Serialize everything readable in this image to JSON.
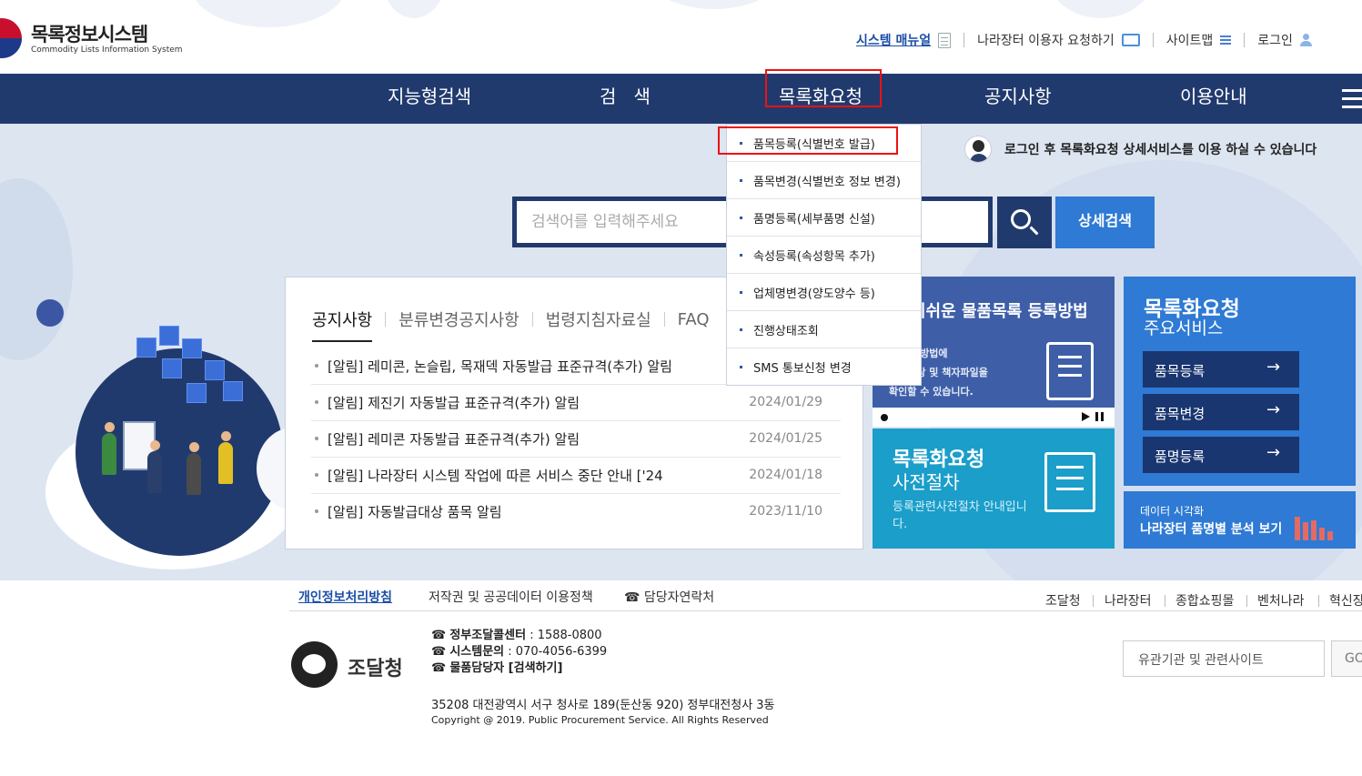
{
  "header": {
    "logo_title": "목록정보시스템",
    "logo_subtitle": "Commodity Lists Information System",
    "util": {
      "manual": "시스템 매뉴얼",
      "user_request": "나라장터 이용자 요청하기",
      "sitemap": "사이트맵",
      "login": "로그인"
    }
  },
  "nav": {
    "items": [
      "지능형검색",
      "검   색",
      "목록화요청",
      "공지사항",
      "이용안내"
    ]
  },
  "dropdown": {
    "items": [
      "품목등록(식별번호 발급)",
      "품목변경(식별번호 정보 변경)",
      "품명등록(세부품명 신설)",
      "속성등록(속성항목 추가)",
      "업체명변경(양도양수 등)",
      "진행상태조회",
      "SMS 통보신청 변경"
    ]
  },
  "hero": {
    "login_message": "로그인 후 목록화요청 상세서비스를 이용 하실 수 있습니다",
    "search_placeholder": "검색어를 입력해주세요",
    "advanced_search": "상세검색"
  },
  "notice": {
    "tabs": [
      "공지사항",
      "분류변경공지사항",
      "법령지침자료실",
      "FAQ"
    ],
    "items": [
      {
        "title": "[알림] 레미콘, 논슬립, 목재덱 자동발급 표준규격(추가) 알림",
        "date": ""
      },
      {
        "title": "[알림] 제진기 자동발급 표준규격(추가) 알림",
        "date": "2024/01/29"
      },
      {
        "title": "[알림] 레미콘 자동발급 표준규격(추가) 알림",
        "date": "2024/01/25"
      },
      {
        "title": "[알림] 나라장터 시스템 작업에 따른 서비스 중단 안내 ['24",
        "date": "2024/01/18"
      },
      {
        "title": "[알림] 자동발급대상 품목 알림",
        "date": "2023/11/10"
      }
    ]
  },
  "cards": {
    "guide": {
      "title": "기쉬운 물품목록 등록방법",
      "text": "록 등록방법에\n교육영상 및 책자파일을\n확인할 수 있습니다."
    },
    "preprocedure": {
      "title1": "목록화요청",
      "title2": "사전절차",
      "text": "등록관련사전절차 안내입니다."
    },
    "services": {
      "title1": "목록화요청",
      "title2": "주요서비스",
      "items": [
        "품목등록",
        "품목변경",
        "품명등록"
      ],
      "arrow": "→"
    },
    "visual": {
      "line1": "데이터 시각화",
      "line2": "나라장터 품명별 분석 보기"
    }
  },
  "footer": {
    "links_left": [
      "개인정보처리방침",
      "저작권 및 공공데이터 이용정책",
      "☎ 담당자연락처"
    ],
    "links_right": [
      "조달청",
      "나라장터",
      "종합쇼핑몰",
      "벤처나라",
      "혁신장"
    ],
    "org_name": "조달청",
    "contact": [
      {
        "icon": "☎",
        "label": "정부조달콜센터",
        "value": " : 1588-0800"
      },
      {
        "icon": "☎",
        "label": "시스템문의",
        "value": " : 070-4056-6399"
      },
      {
        "icon": "☎",
        "label": "물품담당자 [검색하기]",
        "value": ""
      }
    ],
    "address": "35208 대전광역시 서구 청사로 189(둔산동 920) 정부대전청사 3동",
    "copyright": "Copyright @ 2019. Public Procurement Service. All Rights Reserved",
    "site_select": "유관기관 및 관련사이트",
    "go": "GO"
  }
}
